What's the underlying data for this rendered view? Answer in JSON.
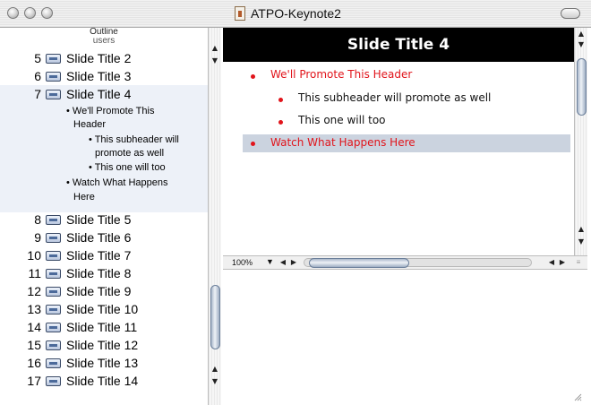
{
  "window": {
    "title": "ATPO-Keynote2"
  },
  "outline": {
    "header_title": "Outline",
    "header_subtitle": "users",
    "slides": [
      {
        "num": "5",
        "label": "Slide Title 2"
      },
      {
        "num": "6",
        "label": "Slide Title 3"
      },
      {
        "num": "7",
        "label": "Slide Title 4"
      },
      {
        "num": "8",
        "label": "Slide Title 5"
      },
      {
        "num": "9",
        "label": "Slide Title 6"
      },
      {
        "num": "10",
        "label": "Slide Title 7"
      },
      {
        "num": "11",
        "label": "Slide Title 8"
      },
      {
        "num": "12",
        "label": "Slide Title 9"
      },
      {
        "num": "13",
        "label": "Slide Title 10"
      },
      {
        "num": "14",
        "label": "Slide Title 11"
      },
      {
        "num": "15",
        "label": "Slide Title 12"
      },
      {
        "num": "16",
        "label": "Slide Title 13"
      },
      {
        "num": "17",
        "label": "Slide Title 14"
      }
    ],
    "selected_children": [
      "• We'll Promote This",
      "Header",
      "• This subheader will",
      "promote as well",
      "• This one will too",
      "• Watch What Happens",
      "Here"
    ]
  },
  "slide": {
    "title": "Slide Title 4",
    "bullets": [
      {
        "text": "We'll Promote This Header",
        "level": 1
      },
      {
        "text": "This subheader will promote as well",
        "level": 2
      },
      {
        "text": "This one will too",
        "level": 2
      },
      {
        "text": "Watch What Happens Here",
        "level": 1
      }
    ]
  },
  "status": {
    "zoom": "100%"
  },
  "colors": {
    "bullet_red": "#e1141b",
    "highlight": "#cbd3df",
    "selection": "#edf1f8"
  }
}
